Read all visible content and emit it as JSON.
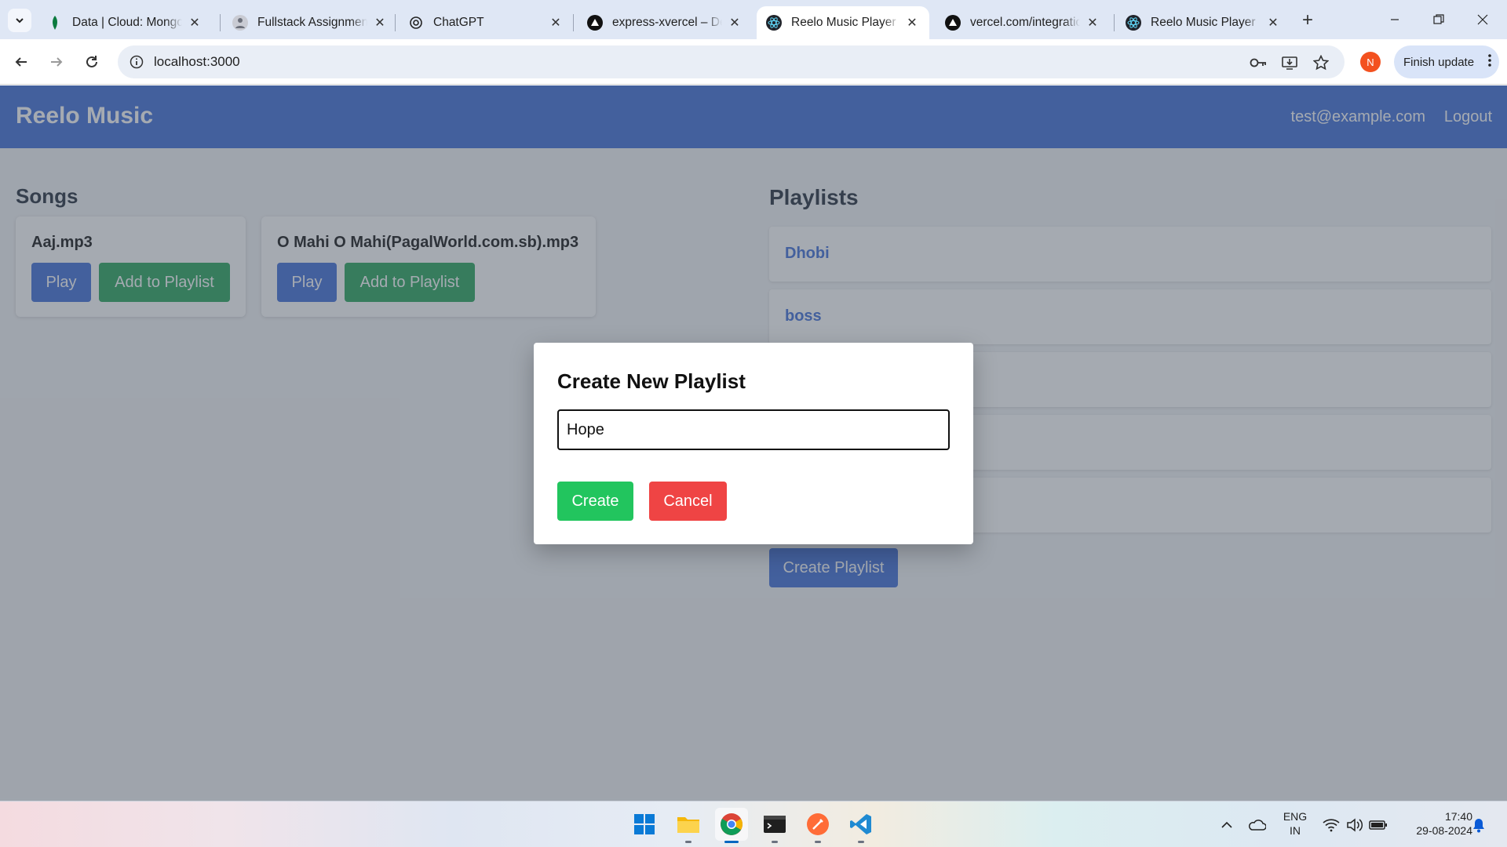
{
  "browser": {
    "tabs": [
      {
        "title": "Data | Cloud: MongoDB Cloud",
        "icon": "mongodb-leaf-icon"
      },
      {
        "title": "Fullstack Assignment",
        "icon": "person-avatar-icon"
      },
      {
        "title": "ChatGPT",
        "icon": "openai-icon"
      },
      {
        "title": "express-xvercel – Deployment",
        "icon": "vercel-triangle-icon"
      },
      {
        "title": "Reelo Music Player",
        "icon": "react-icon",
        "active": true
      },
      {
        "title": "vercel.com/integrations",
        "icon": "vercel-triangle-icon"
      },
      {
        "title": "Reelo Music Player",
        "icon": "react-icon"
      }
    ],
    "url": "localhost:3000",
    "profile_initial": "N",
    "finish_update": "Finish update"
  },
  "app": {
    "brand": "Reelo Music",
    "user_email": "test@example.com",
    "logout": "Logout",
    "songs_title": "Songs",
    "playlists_title": "Playlists",
    "songs": [
      {
        "name": "Aaj.mp3",
        "play": "Play",
        "add": "Add to Playlist"
      },
      {
        "name": "O Mahi O Mahi(PagalWorld.com.sb).mp3",
        "play": "Play",
        "add": "Add to Playlist"
      }
    ],
    "playlists": [
      "Dhobi",
      "boss",
      "",
      "",
      ""
    ],
    "create_playlist": "Create Playlist"
  },
  "modal": {
    "title": "Create New Playlist",
    "input_value": "Hope",
    "create": "Create",
    "cancel": "Cancel"
  },
  "taskbar": {
    "lang_top": "ENG",
    "lang_bottom": "IN",
    "time": "17:40",
    "date": "29-08-2024"
  },
  "colors": {
    "header": "#3b6ad6",
    "add_button": "#22a356",
    "create_button": "#22c55e",
    "cancel_button": "#ef4444"
  }
}
